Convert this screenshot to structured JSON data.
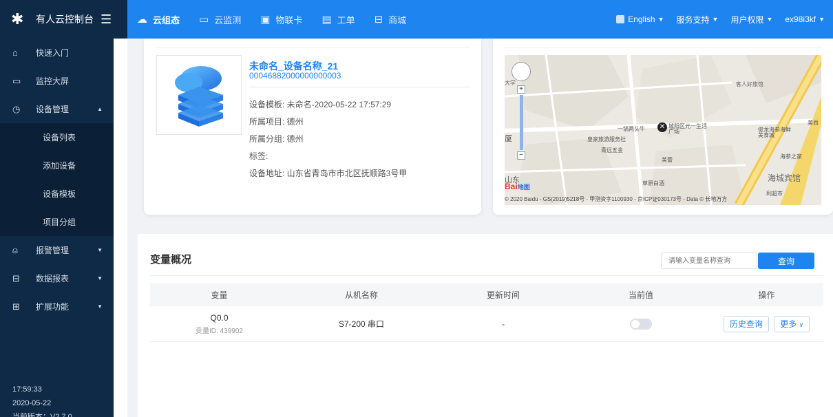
{
  "brand": {
    "title": "有人云控制台",
    "logo_icon": "asterisk-logo-icon"
  },
  "nav": {
    "tabs": [
      {
        "label": "云组态",
        "icon": "cloud-icon"
      },
      {
        "label": "云监测",
        "icon": "monitor-icon"
      },
      {
        "label": "物联卡",
        "icon": "sim-card-icon"
      },
      {
        "label": "工单",
        "icon": "ticket-icon"
      },
      {
        "label": "商城",
        "icon": "store-icon"
      }
    ],
    "language": "English",
    "support": "服务支持",
    "permissions": "用户权限",
    "user": "ex98i3kf"
  },
  "sidebar": {
    "items": [
      {
        "label": "快速入门",
        "icon": "home-icon"
      },
      {
        "label": "监控大屏",
        "icon": "screen-icon"
      },
      {
        "label": "设备管理",
        "icon": "clock-icon"
      },
      {
        "label": "报警管理",
        "icon": "bell-icon"
      },
      {
        "label": "数据报表",
        "icon": "report-icon"
      },
      {
        "label": "扩展功能",
        "icon": "grid-icon"
      }
    ],
    "sub_items": [
      {
        "label": "设备列表"
      },
      {
        "label": "添加设备"
      },
      {
        "label": "设备模板"
      },
      {
        "label": "项目分组"
      }
    ],
    "time": "17:59:33",
    "date": "2020-05-22",
    "version": "当前版本：V2.7.0"
  },
  "device": {
    "name": "未命名_设备名称_21",
    "id": "00046882000000000003",
    "template": "设备模板: 未命名-2020-05-22 17:57:29",
    "project": "所属项目: 德州",
    "group": "所属分组: 德州",
    "tags": "标签:",
    "address": "设备地址: 山东省青岛市市北区抚顺路3号甲"
  },
  "map": {
    "labels": {
      "daxue": "大学",
      "hotel1": "客人好旅馆",
      "pot": "一锅两头牛",
      "square": "城阳区元一生活广场",
      "seafood": "俊龙海参海鲜美食城",
      "mei": "美尚",
      "huangjia": "皇家旅游服务社",
      "qingyuan": "青远五金",
      "haishen": "海参之家",
      "xia": "厦",
      "meiyou": "美蕾",
      "hotel2": "海城宾馆",
      "caoyuan": "草原白酒",
      "shan": "山东",
      "baidu": "Bai",
      "baidu_map": "地图",
      "supermarket": "利超市"
    },
    "copyright": "© 2020 Baidu - GS(2019)5218号 - 甲测资字1100930 - 京ICP证030173号 - Data © 长地万方"
  },
  "variables": {
    "title": "变量概况",
    "search_placeholder": "请输入变量名称查询",
    "search_button": "查询",
    "columns": [
      "变量",
      "从机名称",
      "更新时间",
      "当前值",
      "操作"
    ],
    "rows": [
      {
        "name": "Q0.0",
        "var_id": "变量ID: 439902",
        "slave": "S7-200 串口",
        "updated": "-",
        "value_on": false,
        "history_label": "历史查询",
        "more_label": "更多"
      }
    ]
  },
  "colors": {
    "primary": "#1e84f0",
    "sidebar": "#0f2a47"
  }
}
